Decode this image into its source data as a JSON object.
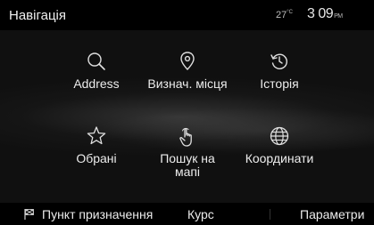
{
  "header": {
    "title": "Навігація",
    "temperature": "27",
    "temperature_unit": "°C",
    "time": "3 09",
    "ampm": "PM"
  },
  "menu": {
    "items": [
      {
        "label": "Address",
        "icon": "search-icon"
      },
      {
        "label": "Визнач. місця",
        "icon": "location-pin-icon"
      },
      {
        "label": "Історія",
        "icon": "history-icon"
      },
      {
        "label": "Обрані",
        "icon": "star-icon"
      },
      {
        "label": "Пошук на мапі",
        "icon": "touch-hand-icon"
      },
      {
        "label": "Координати",
        "icon": "globe-icon"
      }
    ]
  },
  "bottom": {
    "destination_label": "Пункт призначення",
    "route_label": "Курс",
    "settings_label": "Параметри",
    "destination_icon": "checkered-flag-icon"
  }
}
